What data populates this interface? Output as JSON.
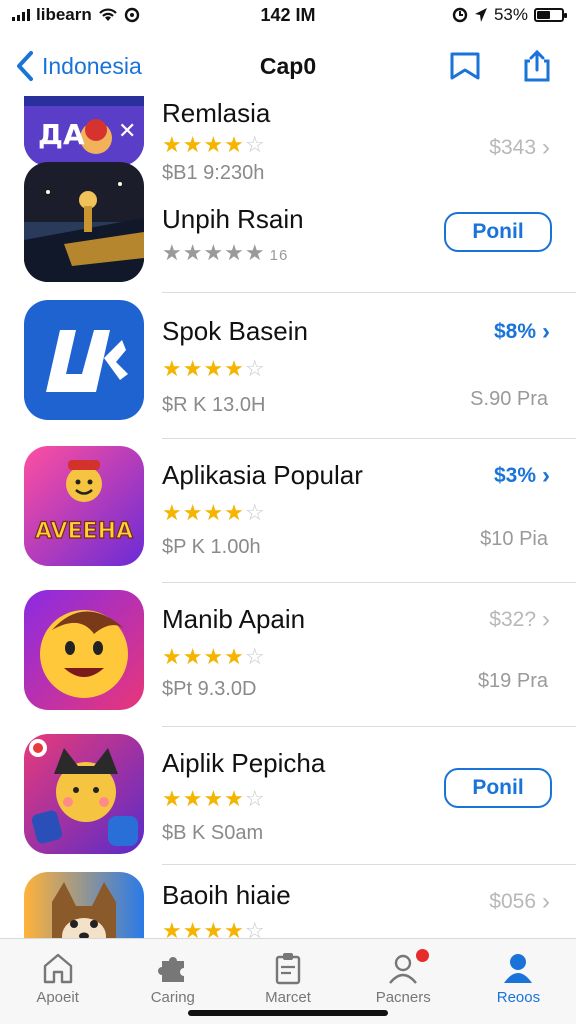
{
  "status": {
    "carrier": "libearn",
    "time": "142 IM",
    "battery": "53%",
    "battery_level": 0.53
  },
  "nav": {
    "back_label": "Indonesia",
    "title": "Cap0"
  },
  "apps": [
    {
      "name": "Remlasia",
      "stars": 4,
      "stars_style": "gold",
      "sub": "$B1 9:230h",
      "price": "$343",
      "price_style": "grey",
      "price_sub": "",
      "action": "price"
    },
    {
      "name": "Unpih Rsain",
      "stars": 5,
      "stars_style": "grey",
      "rating_count": "16",
      "sub": "",
      "price": "",
      "price_sub": "",
      "action": "get",
      "get_label": "Ponil"
    },
    {
      "name": "Spok Basein",
      "stars": 4,
      "stars_style": "gold",
      "sub": "$R  K 13.0H",
      "price": "$8%",
      "price_style": "blue",
      "price_sub": "S.90 Pra",
      "action": "price"
    },
    {
      "name": "Aplikasia Popular",
      "stars": 4,
      "stars_style": "gold",
      "sub": "$P  K 1.00h",
      "price": "$3%",
      "price_style": "blue",
      "price_sub": "$10 Pia",
      "action": "price",
      "icon_text": "AVEEHA"
    },
    {
      "name": "Manib Apain",
      "stars": 4,
      "stars_style": "gold",
      "sub": "$Pt 9.3.0D",
      "price": "$32?",
      "price_style": "grey",
      "price_sub": "$19 Pra",
      "action": "price"
    },
    {
      "name": "Aiplik Pepicha",
      "stars": 4,
      "stars_style": "gold",
      "sub": "$B  K S0am",
      "price": "",
      "price_sub": "",
      "action": "get",
      "get_label": "Ponil"
    },
    {
      "name": "Baoih hiaie",
      "stars": 4,
      "stars_style": "gold",
      "sub": "",
      "price": "$056",
      "price_style": "grey",
      "price_sub": "",
      "action": "price"
    }
  ],
  "tabs": [
    {
      "label": "Apoeit",
      "icon": "home-icon"
    },
    {
      "label": "Caring",
      "icon": "puzzle-icon"
    },
    {
      "label": "Marcet",
      "icon": "clipboard-icon"
    },
    {
      "label": "Pacners",
      "icon": "person-badge-icon"
    },
    {
      "label": "Reoos",
      "icon": "person-filled-icon"
    }
  ],
  "colors": {
    "accent": "#1a73d9",
    "star": "#f5b400",
    "badge": "#e52b2b"
  }
}
